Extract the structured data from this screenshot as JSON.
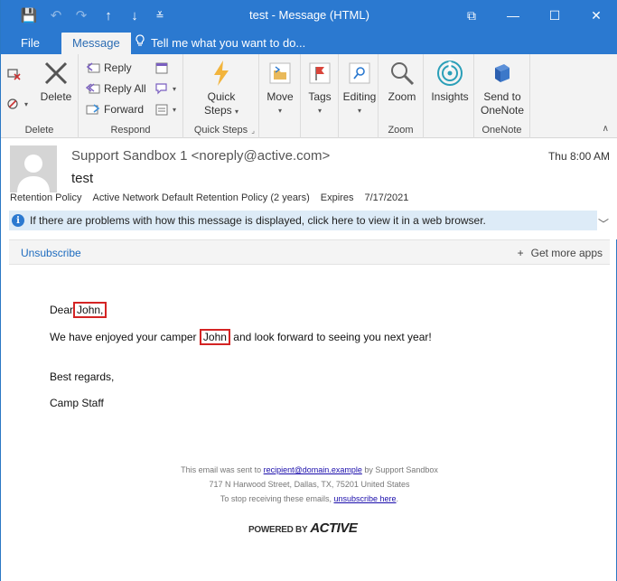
{
  "window": {
    "title": "test - Message (HTML)",
    "controls": {
      "options": "⧉",
      "minimize": "—",
      "maximize": "☐",
      "close": "✕"
    }
  },
  "quick_access": {
    "save": "💾",
    "undo": "↶",
    "redo": "↷",
    "up": "↑",
    "down": "↓",
    "more": "≚"
  },
  "tabs": [
    {
      "label": "File",
      "active": false
    },
    {
      "label": "Message",
      "active": true
    }
  ],
  "tell_me": "Tell me what you want to do...",
  "ribbon": {
    "groups": {
      "delete": "Delete",
      "respond": "Respond",
      "quick_steps": "Quick Steps",
      "zoom": "Zoom",
      "onenote": "OneNote"
    },
    "buttons": {
      "delete": "Delete",
      "reply": "Reply",
      "reply_all": "Reply All",
      "forward": "Forward",
      "quick_steps_line1": "Quick",
      "quick_steps_line2": "Steps",
      "move": "Move",
      "tags": "Tags",
      "editing": "Editing",
      "zoom": "Zoom",
      "insights": "Insights",
      "send_onenote_line1": "Send to",
      "send_onenote_line2": "OneNote"
    }
  },
  "message": {
    "sender": "Support Sandbox 1 <noreply@active.com>",
    "subject": "test",
    "date": "Thu 8:00 AM",
    "policy": {
      "label": "Retention Policy",
      "value": "Active Network Default Retention Policy (2 years)",
      "expires_label": "Expires",
      "expires_value": "7/17/2021"
    },
    "info_bar": "If there are problems with how this message is displayed, click here to view it in a web browser.",
    "unsubscribe": "Unsubscribe",
    "get_more_apps": "Get more apps"
  },
  "body": {
    "greeting_prefix": "Dear",
    "greeting_name": "John,",
    "line2_prefix": "We have enjoyed your camper",
    "line2_name": "John",
    "line2_suffix": "and look forward to seeing you next year!",
    "closing": "Best regards,",
    "signature": "Camp Staff"
  },
  "footer": {
    "sent_prefix": "This email was sent to",
    "sent_email": "recipient@domain.example",
    "sent_suffix": "by Support Sandbox",
    "address": "717 N Harwood Street, Dallas, TX, 75201 United States",
    "stop_prefix": "To stop receiving these emails,",
    "stop_link": "unsubscribe here",
    "stop_suffix": ".",
    "powered_by": "POWERED BY",
    "brand": "ACTIVE"
  },
  "colors": {
    "accent": "#2b79d0",
    "highlight_border": "#d42424",
    "link": "#1e6cbf"
  }
}
